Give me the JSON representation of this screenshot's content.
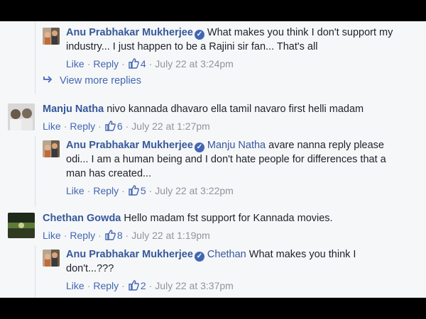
{
  "comments": [
    {
      "author": "Anu Prabhakar Mukherjee",
      "mention": "",
      "text_line1": "What makes you think I don't support my",
      "text_line2": "industry... I just happen to be a Rajini sir fan... That's all",
      "text_line3": "",
      "like": "Like",
      "reply": "Reply",
      "likes": "4",
      "time": "July 22 at 3:24pm"
    },
    {
      "author": "Manju Natha",
      "mention": "",
      "text_line1": "nivo kannada dhavaro ella tamil navaro first helli madam",
      "like": "Like",
      "reply": "Reply",
      "likes": "6",
      "time": "July 22 at 1:27pm"
    },
    {
      "author": "Anu Prabhakar Mukherjee",
      "mention": "Manju Natha",
      "text_line1": "avare nanna reply please",
      "text_line2": "odi... I am a human being and I don't hate people for differences that a",
      "text_line3": "man has created...",
      "like": "Like",
      "reply": "Reply",
      "likes": "5",
      "time": "July 22 at 3:22pm"
    },
    {
      "author": "Chethan Gowda",
      "mention": "",
      "text_line1": "Hello madam fst support for Kannada movies.",
      "like": "Like",
      "reply": "Reply",
      "likes": "8",
      "time": "July 22 at 1:19pm"
    },
    {
      "author": "Anu Prabhakar Mukherjee",
      "mention": "Chethan",
      "text_line1": "What makes you think I",
      "text_line2": "don't...???",
      "like": "Like",
      "reply": "Reply",
      "likes": "2",
      "time": "July 22 at 3:37pm"
    }
  ],
  "view_more_replies": "View more replies",
  "icons": {
    "verified": "verified-badge-icon",
    "like": "thumbs-up-icon",
    "reply_arrow": "reply-arrow-icon"
  },
  "colors": {
    "link": "#365899",
    "action": "#4267b2",
    "muted": "#90949c",
    "background": "#f6f7f9"
  }
}
